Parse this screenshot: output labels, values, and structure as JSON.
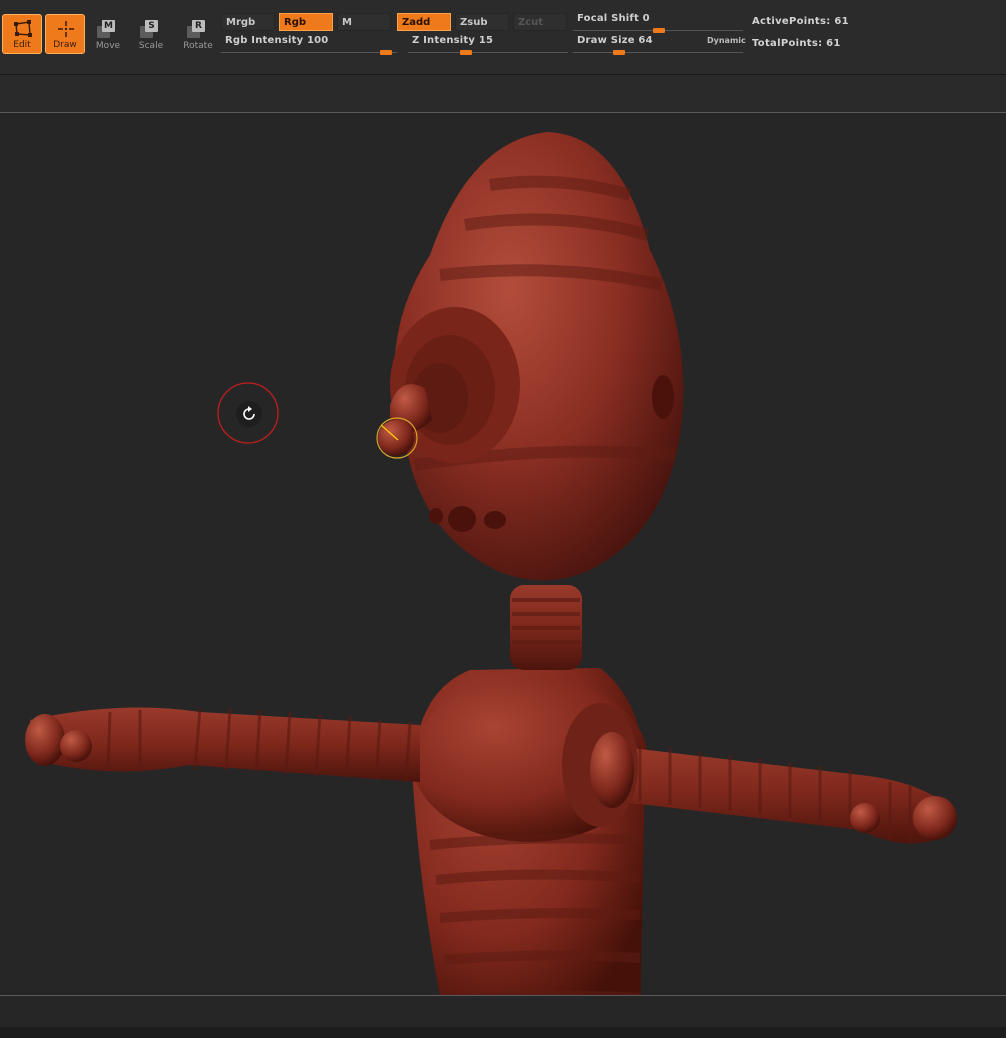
{
  "tools": [
    {
      "label": "Edit",
      "active": true,
      "icon": "edit-icon"
    },
    {
      "label": "Draw",
      "active": true,
      "icon": "draw-icon"
    },
    {
      "label": "Move",
      "active": false,
      "key": "M",
      "icon": "move-icon"
    },
    {
      "label": "Scale",
      "active": false,
      "key": "S",
      "icon": "scale-icon"
    },
    {
      "label": "Rotate",
      "active": false,
      "key": "R",
      "icon": "rotate-icon"
    }
  ],
  "modes": {
    "mrgb": "Mrgb",
    "rgb": "Rgb",
    "m": "M",
    "zadd": "Zadd",
    "zsub": "Zsub",
    "zcut": "Zcut"
  },
  "sliders": {
    "rgb_intensity": {
      "label": "Rgb  Intensity 100",
      "value": 100,
      "max": 100
    },
    "z_intensity": {
      "label": "Z  Intensity 15",
      "value": 15,
      "max": 100
    },
    "focal_shift": {
      "label": "Focal  Shift 0",
      "value": 0,
      "min": -100,
      "max": 100
    },
    "draw_size": {
      "label": "Draw  Size 64",
      "value": 64,
      "max": 1000,
      "extra": "Dynamic"
    }
  },
  "stats": {
    "active_points": "ActivePoints: 61",
    "total_points": "TotalPoints: 61"
  },
  "colors": {
    "accent": "#ee7a1c",
    "model": "#8a2e22",
    "background": "#262626"
  }
}
